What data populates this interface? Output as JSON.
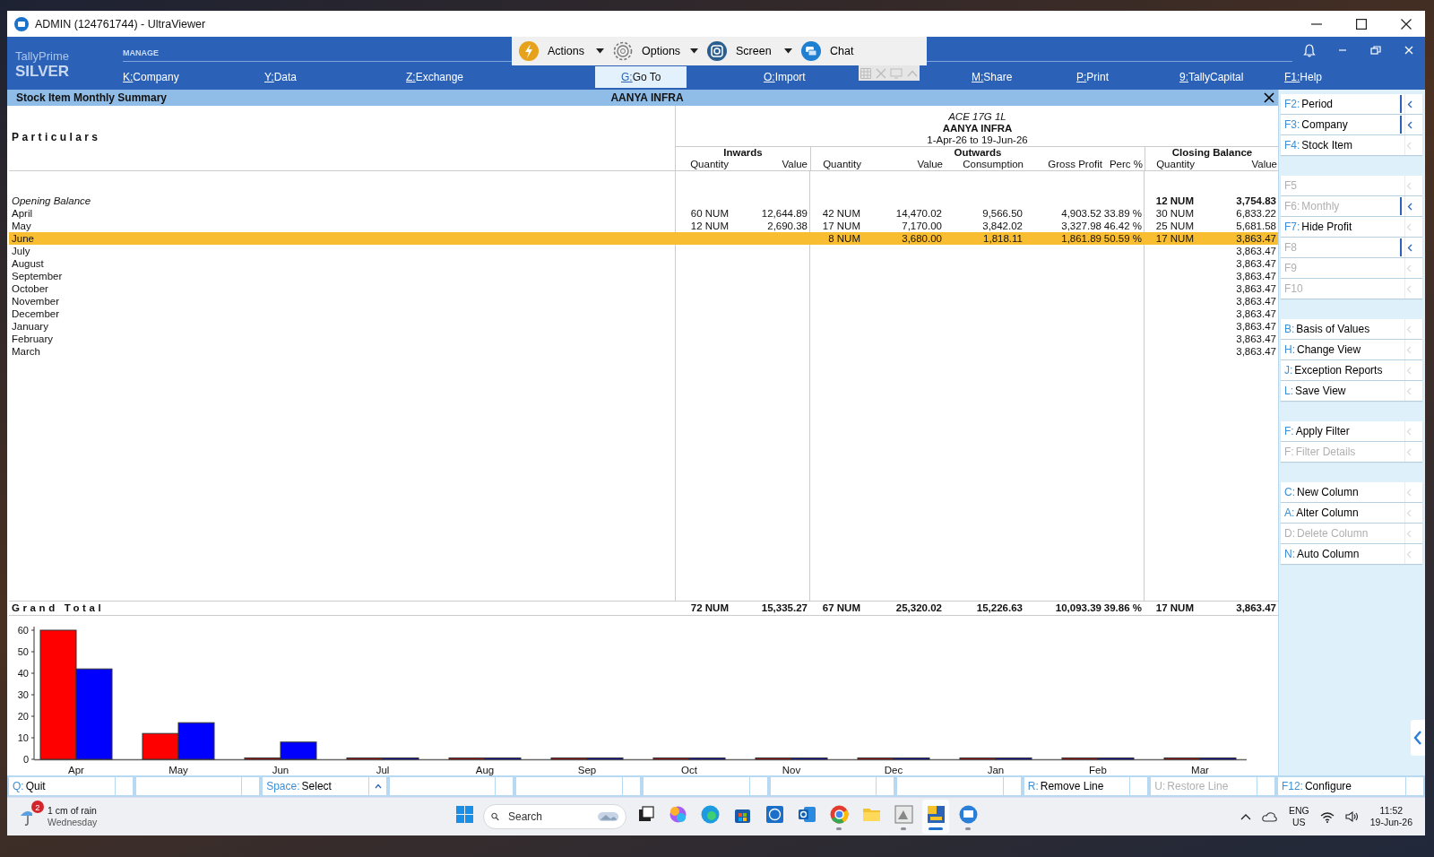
{
  "window": {
    "title": "ADMIN (124761744) - UltraViewer"
  },
  "remote_toolbar": {
    "buttons": [
      {
        "kind": "actions",
        "label": "Actions",
        "dropdown": true
      },
      {
        "kind": "options",
        "label": "Options",
        "dropdown": true
      },
      {
        "kind": "screen",
        "label": "Screen",
        "dropdown": true
      },
      {
        "kind": "chat",
        "label": "Chat",
        "dropdown": false
      }
    ]
  },
  "app_header": {
    "product": "TallyPrime",
    "edition": "SILVER",
    "section": "MANAGE",
    "menu": [
      {
        "key": "K:",
        "label": "Company",
        "selected": false
      },
      {
        "key": "Y:",
        "label": "Data",
        "selected": false
      },
      {
        "key": "Z:",
        "label": "Exchange",
        "selected": false
      },
      {
        "key": "G:",
        "label": "Go To",
        "selected": true
      },
      {
        "key": "O:",
        "label": "Import",
        "selected": false
      },
      {
        "key": "M:",
        "label": "Share",
        "selected": false
      },
      {
        "key": "P:",
        "label": "Print",
        "selected": false
      },
      {
        "key": "9:",
        "label": "TallyCapital",
        "selected": false
      },
      {
        "key": "F1:",
        "label": "Help",
        "selected": false
      }
    ]
  },
  "report_bar": {
    "title": "Stock Item Monthly Summary",
    "company": "AANYA INFRA"
  },
  "report": {
    "particulars_heading": "Particulars",
    "item": "ACE 17G 1L",
    "company": "AANYA INFRA",
    "period": "1-Apr-26 to 19-Jun-26",
    "groups": [
      {
        "label": "Inwards",
        "columns": [
          "Quantity",
          "Value"
        ]
      },
      {
        "label": "Outwards",
        "columns": [
          "Quantity",
          "Value",
          "Consumption",
          "Gross Profit",
          "Perc %"
        ]
      },
      {
        "label": "Closing Balance",
        "columns": [
          "Quantity",
          "Value"
        ]
      }
    ],
    "rows": [
      {
        "kind": "opening",
        "label": "Opening Balance",
        "selected": false,
        "close_qty": "12 NUM",
        "close_value": "3,754.83"
      },
      {
        "kind": "month",
        "label": "April",
        "selected": false,
        "in_qty": "60 NUM",
        "in_value": "12,644.89",
        "out_qty": "42 NUM",
        "out_value": "14,470.02",
        "consumption": "9,566.50",
        "gross_profit": "4,903.52",
        "perc": "33.89 %",
        "close_qty": "30 NUM",
        "close_value": "6,833.22"
      },
      {
        "kind": "month",
        "label": "May",
        "selected": false,
        "in_qty": "12 NUM",
        "in_value": "2,690.38",
        "out_qty": "17 NUM",
        "out_value": "7,170.00",
        "consumption": "3,842.02",
        "gross_profit": "3,327.98",
        "perc": "46.42 %",
        "close_qty": "25 NUM",
        "close_value": "5,681.58"
      },
      {
        "kind": "month",
        "label": "June",
        "selected": true,
        "out_qty": "8 NUM",
        "out_value": "3,680.00",
        "consumption": "1,818.11",
        "gross_profit": "1,861.89",
        "perc": "50.59 %",
        "close_qty": "17 NUM",
        "close_value": "3,863.47"
      },
      {
        "kind": "month",
        "label": "July",
        "selected": false,
        "close_value": "3,863.47"
      },
      {
        "kind": "month",
        "label": "August",
        "selected": false,
        "close_value": "3,863.47"
      },
      {
        "kind": "month",
        "label": "September",
        "selected": false,
        "close_value": "3,863.47"
      },
      {
        "kind": "month",
        "label": "October",
        "selected": false,
        "close_value": "3,863.47"
      },
      {
        "kind": "month",
        "label": "November",
        "selected": false,
        "close_value": "3,863.47"
      },
      {
        "kind": "month",
        "label": "December",
        "selected": false,
        "close_value": "3,863.47"
      },
      {
        "kind": "month",
        "label": "January",
        "selected": false,
        "close_value": "3,863.47"
      },
      {
        "kind": "month",
        "label": "February",
        "selected": false,
        "close_value": "3,863.47"
      },
      {
        "kind": "month",
        "label": "March",
        "selected": false,
        "close_value": "3,863.47"
      }
    ],
    "grand_total": {
      "label": "Grand Total",
      "in_qty": "72 NUM",
      "in_value": "15,335.27",
      "out_qty": "67 NUM",
      "out_value": "25,320.02",
      "consumption": "15,226.63",
      "gross_profit": "10,093.39",
      "perc": "39.86 %",
      "close_qty": "17 NUM",
      "close_value": "3,863.47"
    },
    "chart_data": {
      "type": "bar",
      "categories": [
        "Apr",
        "May",
        "Jun",
        "Jul",
        "Aug",
        "Sep",
        "Oct",
        "Nov",
        "Dec",
        "Jan",
        "Feb",
        "Mar"
      ],
      "series": [
        {
          "color": "#ff0000",
          "values": [
            60,
            12,
            0,
            0,
            0,
            0,
            0,
            0,
            0,
            0,
            0,
            0
          ]
        },
        {
          "color": "#0000ff",
          "values": [
            42,
            17,
            8,
            0,
            0,
            0,
            0,
            0,
            0,
            0,
            0,
            0
          ]
        }
      ],
      "ylim": [
        0,
        60
      ],
      "yticks": [
        0,
        10,
        20,
        30,
        40,
        50,
        60
      ]
    }
  },
  "sidebar": {
    "groups": [
      [
        {
          "key": "F2:",
          "label": "Period",
          "disabled": false,
          "submenu": true
        },
        {
          "key": "F3:",
          "label": "Company",
          "disabled": false,
          "submenu": true
        },
        {
          "key": "F4:",
          "label": "Stock Item",
          "disabled": false,
          "submenu": false
        }
      ],
      [
        {
          "key": "F5",
          "disabled": true,
          "submenu": false
        },
        {
          "key": "F6:",
          "label": "Monthly",
          "disabled": true,
          "submenu": true
        },
        {
          "key": "F7:",
          "label": "Hide Profit",
          "disabled": false,
          "submenu": false
        },
        {
          "key": "F8",
          "disabled": true,
          "submenu": true
        },
        {
          "key": "F9",
          "disabled": true,
          "submenu": false
        },
        {
          "key": "F10",
          "disabled": true,
          "submenu": false
        }
      ],
      [
        {
          "key": "B:",
          "label": "Basis of Values",
          "disabled": false,
          "submenu": false
        },
        {
          "key": "H:",
          "label": "Change View",
          "disabled": false,
          "submenu": false
        },
        {
          "key": "J:",
          "label": "Exception Reports",
          "disabled": false,
          "submenu": false
        },
        {
          "key": "L:",
          "label": "Save View",
          "disabled": false,
          "submenu": false
        }
      ],
      [
        {
          "key": "F:",
          "label": "Apply Filter",
          "disabled": false,
          "submenu": false
        },
        {
          "key": "F:",
          "label": "Filter Details",
          "disabled": true,
          "submenu": false
        }
      ],
      [
        {
          "key": "C:",
          "label": "New Column",
          "disabled": false,
          "submenu": false
        },
        {
          "key": "A:",
          "label": "Alter Column",
          "disabled": false,
          "submenu": false
        },
        {
          "key": "D:",
          "label": "Delete Column",
          "disabled": true,
          "submenu": false
        },
        {
          "key": "N:",
          "label": "Auto Column",
          "disabled": false,
          "submenu": false
        }
      ]
    ]
  },
  "footer": [
    {
      "kind": "command",
      "key": "Q:",
      "label": "Quit",
      "disabled": false,
      "submenu": false
    },
    {
      "kind": "blank"
    },
    {
      "kind": "command",
      "key": "Space:",
      "label": "Select",
      "disabled": false,
      "submenu": true
    },
    {
      "kind": "blank"
    },
    {
      "kind": "blank"
    },
    {
      "kind": "blank"
    },
    {
      "kind": "blank"
    },
    {
      "kind": "blank"
    },
    {
      "kind": "command",
      "key": "R:",
      "label": "Remove Line",
      "disabled": false,
      "submenu": false
    },
    {
      "kind": "command",
      "key": "U:",
      "label": "Restore Line",
      "disabled": true,
      "submenu": false
    },
    {
      "kind": "command",
      "key": "F12:",
      "label": "Configure",
      "disabled": false,
      "submenu": false
    }
  ],
  "taskbar": {
    "weather": {
      "badge": "2",
      "line_1": "1 cm of rain",
      "line_2": "Wednesday"
    },
    "search": {
      "placeholder": "Search"
    },
    "apps": [
      {
        "kind": "start",
        "running": false,
        "active": false
      },
      {
        "kind": "search"
      },
      {
        "kind": "taskview",
        "running": false,
        "active": false
      },
      {
        "kind": "copilot",
        "running": false,
        "active": false
      },
      {
        "kind": "edge",
        "running": false,
        "active": false
      },
      {
        "kind": "store",
        "running": false,
        "active": false
      },
      {
        "kind": "dell",
        "running": false,
        "active": false
      },
      {
        "kind": "outlook",
        "running": false,
        "active": false
      },
      {
        "kind": "chrome",
        "running": true,
        "active": false
      },
      {
        "kind": "files",
        "running": false,
        "active": false
      },
      {
        "kind": "paint",
        "running": true,
        "active": false
      },
      {
        "kind": "tally",
        "running": true,
        "active": true
      },
      {
        "kind": "ultraviewer",
        "running": true,
        "active": false
      }
    ],
    "tray": {
      "language": "ENG",
      "region": "US",
      "time": "11:52",
      "date": "19-Jun-26"
    }
  }
}
